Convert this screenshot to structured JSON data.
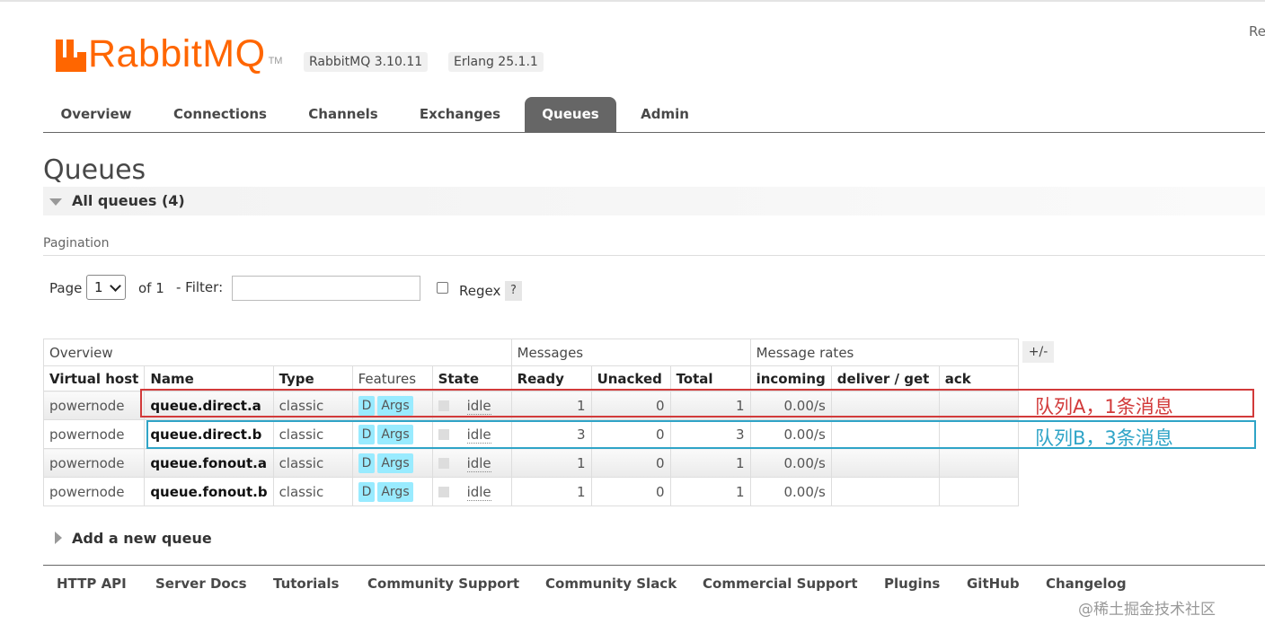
{
  "header": {
    "logo_rabbit": "RabbitMQ",
    "logo_mq": "",
    "logo_tm": "TM",
    "rabbitmq_version": "RabbitMQ 3.10.11",
    "erlang_version": "Erlang 25.1.1",
    "right_fragment": "Re"
  },
  "nav": {
    "tabs": [
      "Overview",
      "Connections",
      "Channels",
      "Exchanges",
      "Queues",
      "Admin"
    ],
    "active": "Queues"
  },
  "page": {
    "title": "Queues",
    "section_title": "All queues (4)"
  },
  "pagination": {
    "label": "Pagination",
    "page_label": "Page",
    "page_value": "1",
    "of_label": "of 1",
    "filter_label": "- Filter:",
    "filter_value": "",
    "regex_label": "Regex",
    "help": "?"
  },
  "table": {
    "groups": [
      "Overview",
      "Messages",
      "Message rates"
    ],
    "columns": [
      "Virtual host",
      "Name",
      "Type",
      "Features",
      "State",
      "Ready",
      "Unacked",
      "Total",
      "incoming",
      "deliver / get",
      "ack"
    ],
    "toggle_label": "+/-",
    "rows": [
      {
        "vhost": "powernode",
        "name": "queue.direct.a",
        "type": "classic",
        "feature_d": "D",
        "feature_args": "Args",
        "state": "idle",
        "ready": "1",
        "unacked": "0",
        "total": "1",
        "incoming": "0.00/s",
        "deliver_get": "",
        "ack": ""
      },
      {
        "vhost": "powernode",
        "name": "queue.direct.b",
        "type": "classic",
        "feature_d": "D",
        "feature_args": "Args",
        "state": "idle",
        "ready": "3",
        "unacked": "0",
        "total": "3",
        "incoming": "0.00/s",
        "deliver_get": "",
        "ack": ""
      },
      {
        "vhost": "powernode",
        "name": "queue.fonout.a",
        "type": "classic",
        "feature_d": "D",
        "feature_args": "Args",
        "state": "idle",
        "ready": "1",
        "unacked": "0",
        "total": "1",
        "incoming": "0.00/s",
        "deliver_get": "",
        "ack": ""
      },
      {
        "vhost": "powernode",
        "name": "queue.fonout.b",
        "type": "classic",
        "feature_d": "D",
        "feature_args": "Args",
        "state": "idle",
        "ready": "1",
        "unacked": "0",
        "total": "1",
        "incoming": "0.00/s",
        "deliver_get": "",
        "ack": ""
      }
    ]
  },
  "annotations": {
    "queue_a": "队列A，1条消息",
    "queue_b": "队列B，3条消息",
    "color_a": "#d23a3a",
    "color_b": "#2fa4c7"
  },
  "add_queue": "Add a new queue",
  "footer": {
    "links": [
      "HTTP API",
      "Server Docs",
      "Tutorials",
      "Community Support",
      "Community Slack",
      "Commercial Support",
      "Plugins",
      "GitHub",
      "Changelog"
    ]
  },
  "watermark": "@稀土掘金技术社区",
  "colors": {
    "brand": "#ff6600",
    "nav_active": "#666666",
    "badge": "#99ebff"
  }
}
